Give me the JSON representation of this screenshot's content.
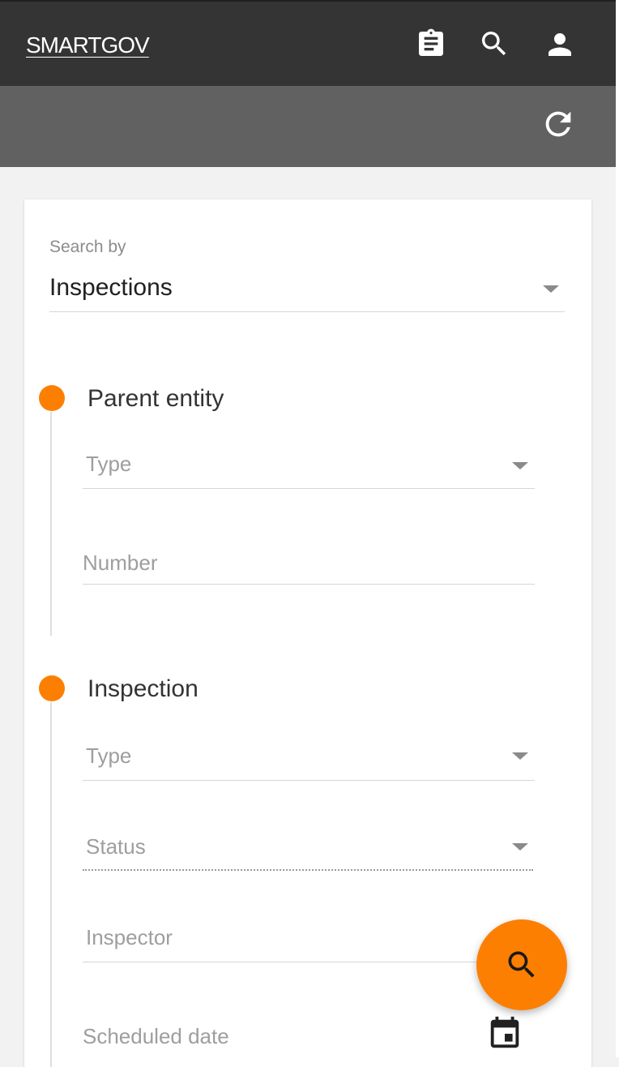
{
  "app": {
    "brand": "SMARTGOV"
  },
  "header": {
    "icons": [
      "clipboard-icon",
      "search-icon",
      "account-icon"
    ],
    "sub_icons": [
      "refresh-icon"
    ]
  },
  "search": {
    "label": "Search by",
    "value": "Inspections"
  },
  "sections": {
    "parent": {
      "title": "Parent entity",
      "type_placeholder": "Type",
      "number_placeholder": "Number"
    },
    "inspection": {
      "title": "Inspection",
      "type_placeholder": "Type",
      "status_placeholder": "Status",
      "inspector_placeholder": "Inspector",
      "scheduled_date_placeholder": "Scheduled date"
    }
  },
  "fab": {
    "icon": "search-icon"
  },
  "colors": {
    "app_bar": "#343434",
    "sub_bar": "#616161",
    "accent": "#fd7f01",
    "background": "#f2f2f2"
  }
}
